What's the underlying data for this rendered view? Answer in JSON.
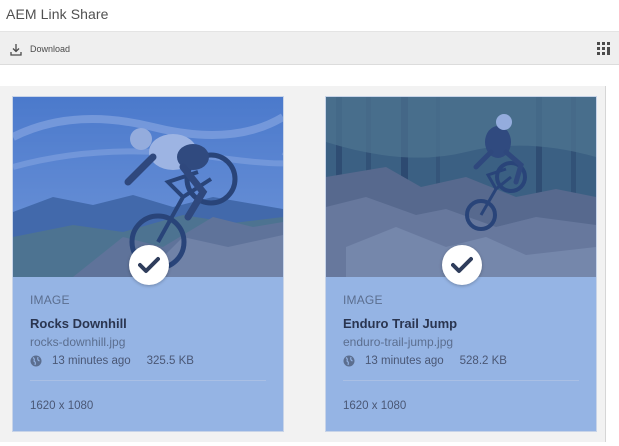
{
  "app": {
    "title": "AEM Link Share"
  },
  "toolbar": {
    "download_label": "Download"
  },
  "cards": [
    {
      "type": "IMAGE",
      "name": "Rocks Downhill",
      "filename": "rocks-downhill.jpg",
      "modified": "13 minutes ago",
      "size": "325.5 KB",
      "dimensions": "1620 x 1080",
      "selected": true
    },
    {
      "type": "IMAGE",
      "name": "Enduro Trail Jump",
      "filename": "enduro-trail-jump.jpg",
      "modified": "13 minutes ago",
      "size": "528.2 KB",
      "dimensions": "1620 x 1080",
      "selected": true
    }
  ],
  "colors": {
    "selection_overlay": "#3769d2",
    "card_selected_bg": "#95b4e4"
  },
  "icons": {
    "download": "download-icon",
    "view_switch": "grid-view-icon",
    "selected": "checkmark-icon",
    "published": "globe-icon"
  }
}
